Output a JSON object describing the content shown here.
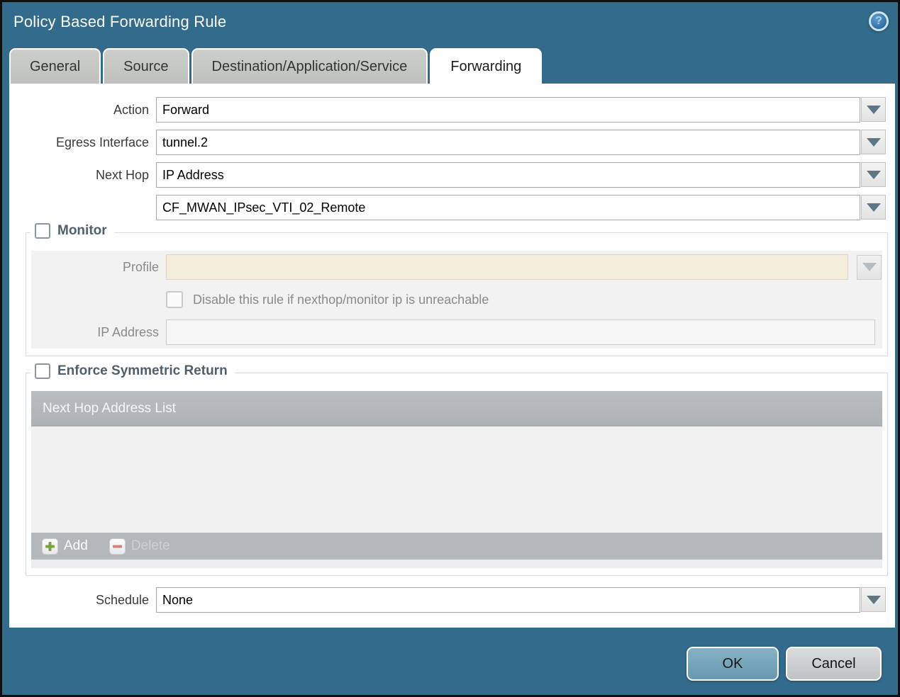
{
  "window": {
    "title": "Policy Based Forwarding Rule"
  },
  "help": {
    "glyph": "?"
  },
  "tabs": [
    {
      "label": "General",
      "active": false
    },
    {
      "label": "Source",
      "active": false
    },
    {
      "label": "Destination/Application/Service",
      "active": false
    },
    {
      "label": "Forwarding",
      "active": true
    }
  ],
  "form": {
    "action": {
      "label": "Action",
      "value": "Forward"
    },
    "egress_interface": {
      "label": "Egress Interface",
      "value": "tunnel.2"
    },
    "next_hop": {
      "label": "Next Hop",
      "value": "IP Address"
    },
    "next_hop_address": {
      "value": "CF_MWAN_IPsec_VTI_02_Remote"
    },
    "schedule": {
      "label": "Schedule",
      "value": "None"
    }
  },
  "monitor": {
    "legend": "Monitor",
    "checked": false,
    "profile": {
      "label": "Profile",
      "value": ""
    },
    "disable_rule": {
      "label": "Disable this rule if nexthop/monitor ip is unreachable",
      "checked": false
    },
    "ip_address": {
      "label": "IP Address",
      "value": ""
    }
  },
  "symmetric_return": {
    "legend": "Enforce Symmetric Return",
    "checked": false,
    "table": {
      "header": "Next Hop Address List",
      "rows": []
    },
    "add_label": "Add",
    "delete_label": "Delete"
  },
  "footer": {
    "ok_label": "OK",
    "cancel_label": "Cancel"
  },
  "colors": {
    "accent_teal": "#326b8b",
    "tab_gray": "#c3c6c3",
    "table_header_gray": "#b3b8ba",
    "disabled_beige": "#f5eedd",
    "ok_button": "#6fa3ba",
    "legend_text": "#4e5f6d"
  }
}
